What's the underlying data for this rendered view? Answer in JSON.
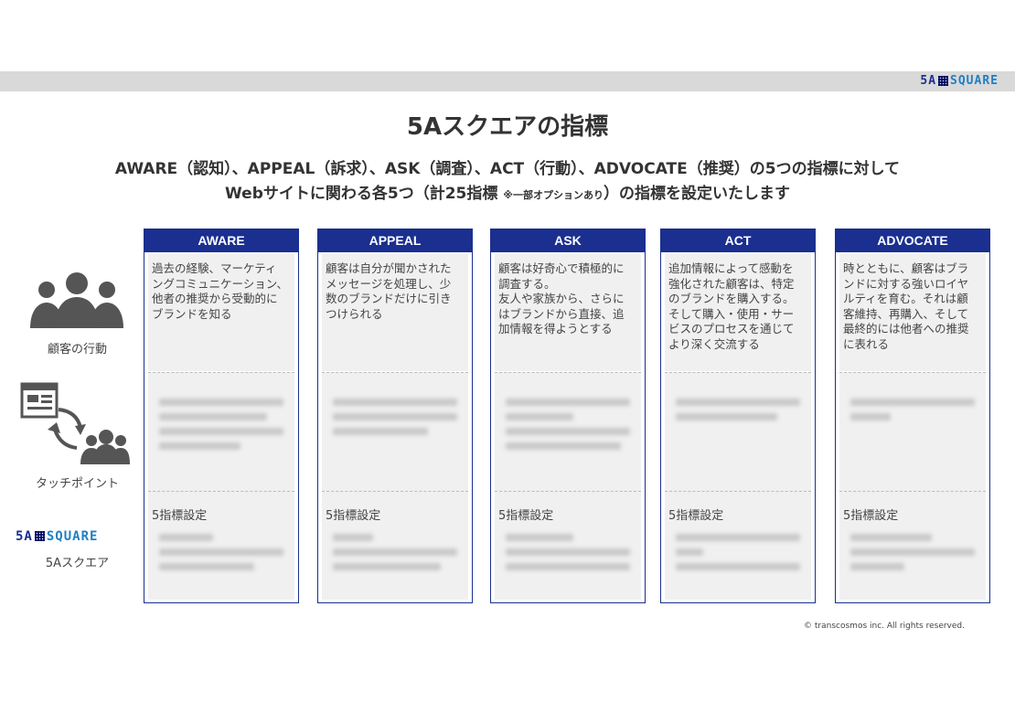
{
  "brand": {
    "logo_text_a": "5A",
    "logo_text_b": "SQUARE"
  },
  "title": "5Aスクエアの指標",
  "subtitle_line1": "AWARE（認知）、APPEAL（訴求）、ASK（調査）、ACT（行動）、ADVOCATE（推奨）の5つの指標に対して",
  "subtitle_line2_a": "Webサイトに関わる各5つ（計25指標 ",
  "subtitle_line2_small": "※一部オプションあり",
  "subtitle_line2_b": "）の指標を設定いたします",
  "side": {
    "customer_action": "顧客の行動",
    "touchpoint": "タッチポイント",
    "square_label": "5Aスクエア"
  },
  "columns": [
    {
      "header": "AWARE",
      "desc": "過去の経験、マーケティ\nングコミュニケーション、\n他者の推奨から受動的に\nブランドを知る",
      "kpi": "5指標設定"
    },
    {
      "header": "APPEAL",
      "desc": "顧客は自分が聞かされた\nメッセージを処理し、少\n数のブランドだけに引き\nつけられる",
      "kpi": "5指標設定"
    },
    {
      "header": "ASK",
      "desc": "顧客は好奇心で積極的に\n調査する。\n友人や家族から、さらに\nはブランドから直接、追\n加情報を得ようとする",
      "kpi": "5指標設定"
    },
    {
      "header": "ACT",
      "desc": "追加情報によって感動を\n強化された顧客は、特定\nのブランドを購入する。\nそして購入・使用・サー\nビスのプロセスを通じて\nより深く交流する",
      "kpi": "5指標設定"
    },
    {
      "header": "ADVOCATE",
      "desc": "時とともに、顧客はブラ\nンドに対する強いロイヤ\nルティを育む。それは顧\n客維持、再購入、そして\n最終的には他者への推奨\nに表れる",
      "kpi": "5指標設定"
    }
  ],
  "copyright": "© transcosmos inc. All rights reserved.",
  "colors": {
    "navy": "#1a2f8f",
    "blue": "#1f7fc4",
    "gray_bar": "#d9d9d9"
  },
  "icons": [
    "people-group-icon",
    "browser-window-icon",
    "exchange-arrows-icon",
    "people-small-icon"
  ]
}
